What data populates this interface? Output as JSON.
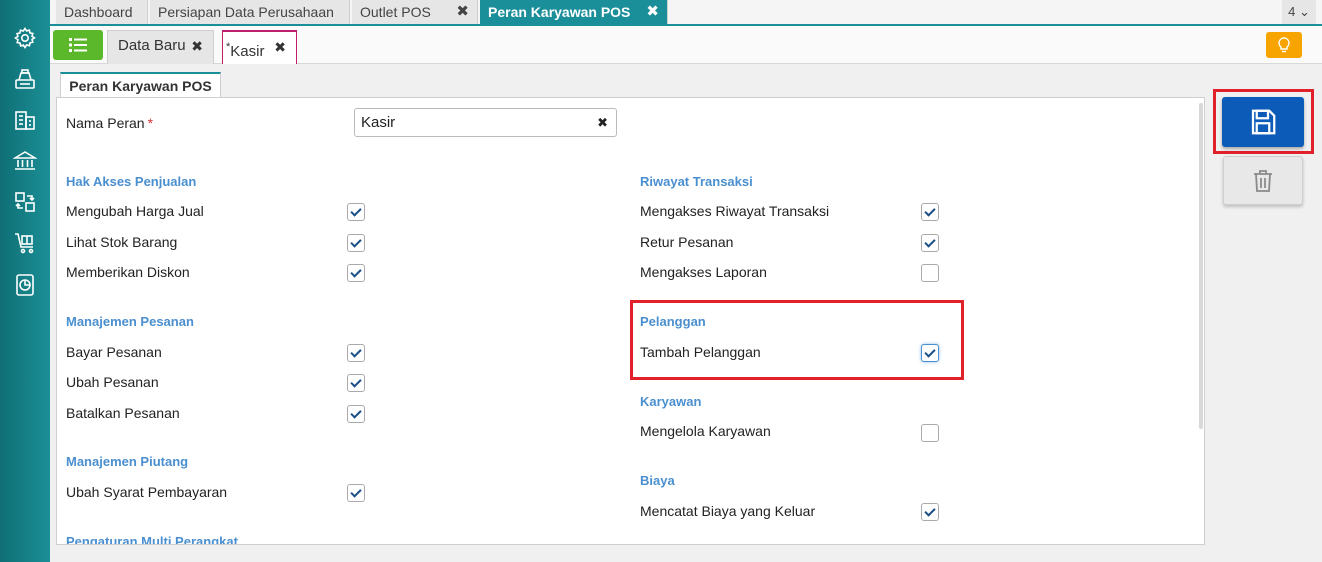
{
  "tabs": [
    {
      "label": "Dashboard",
      "closable": false,
      "active": false
    },
    {
      "label": "Persiapan Data Perusahaan",
      "closable": false,
      "active": false
    },
    {
      "label": "Outlet POS",
      "closable": true,
      "active": false
    },
    {
      "label": "Peran Karyawan POS",
      "closable": true,
      "active": true
    }
  ],
  "tab_count": "4",
  "subtabs": [
    {
      "label": "Data Baru",
      "active": false
    },
    {
      "label": "Kasir",
      "active": true,
      "modified_mark": "*"
    }
  ],
  "form_tab": "Peran Karyawan POS",
  "field": {
    "label": "Nama Peran",
    "required_mark": "*",
    "value": "Kasir"
  },
  "left_sections": [
    {
      "title": "Hak Akses Penjualan",
      "items": [
        {
          "label": "Mengubah Harga Jual",
          "checked": true
        },
        {
          "label": "Lihat Stok Barang",
          "checked": true
        },
        {
          "label": "Memberikan Diskon",
          "checked": true
        }
      ]
    },
    {
      "title": "Manajemen Pesanan",
      "items": [
        {
          "label": "Bayar Pesanan",
          "checked": true
        },
        {
          "label": "Ubah Pesanan",
          "checked": true
        },
        {
          "label": "Batalkan Pesanan",
          "checked": true
        }
      ]
    },
    {
      "title": "Manajemen Piutang",
      "items": [
        {
          "label": "Ubah Syarat Pembayaran",
          "checked": true
        }
      ]
    },
    {
      "title": "Pengaturan Multi Perangkat",
      "items": []
    }
  ],
  "right_sections": [
    {
      "title": "Riwayat Transaksi",
      "items": [
        {
          "label": "Mengakses Riwayat Transaksi",
          "checked": true
        },
        {
          "label": "Retur Pesanan",
          "checked": true
        },
        {
          "label": "Mengakses Laporan",
          "checked": false
        }
      ]
    },
    {
      "title": "Pelanggan",
      "items": [
        {
          "label": "Tambah Pelanggan",
          "checked": true
        }
      ]
    },
    {
      "title": "Karyawan",
      "items": [
        {
          "label": "Mengelola Karyawan",
          "checked": false
        }
      ]
    },
    {
      "title": "Biaya",
      "items": [
        {
          "label": "Mencatat Biaya yang Keluar",
          "checked": true
        }
      ]
    }
  ],
  "icons": {
    "sidebar": [
      "gear-icon",
      "cash-register-icon",
      "building-icon",
      "bank-icon",
      "transfer-icon",
      "cart-icon",
      "report-icon"
    ],
    "close": "✖",
    "tabcount_chevron": "⌄"
  },
  "colors": {
    "accent": "#1a8f9a",
    "save": "#0d5bb8",
    "highlight": "#e0202a",
    "section": "#4a8fcf"
  }
}
